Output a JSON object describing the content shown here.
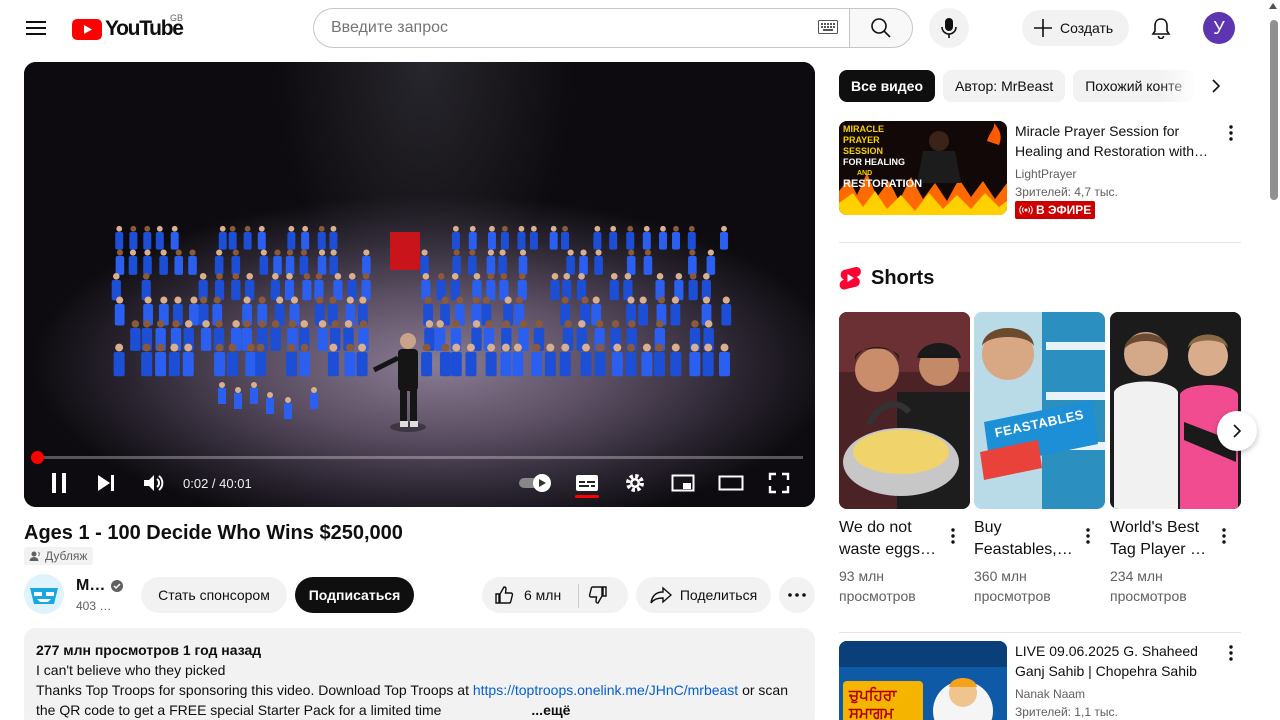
{
  "header": {
    "logo_text": "YouTube",
    "region": "GB",
    "search_placeholder": "Введите запрос",
    "create_label": "Создать",
    "avatar_letter": "У"
  },
  "player": {
    "time_current": "0:02",
    "time_total": "40:01",
    "time_display": "0:02 / 40:01",
    "progress_fraction": 0.001,
    "state": "playing"
  },
  "video": {
    "title": "Ages 1 - 100 Decide Who Wins $250,000",
    "dub_label": "Дубляж",
    "channel_name": "M…",
    "subscribers": "403 …",
    "sponsor_label": "Стать спонсором",
    "subscribe_label": "Подписаться",
    "likes": "6 млн",
    "share_label": "Поделиться"
  },
  "description": {
    "meta": "277 млн просмотров  1 год назад",
    "line1": "I can't believe who they picked",
    "line2_prefix": "Thanks Top Troops for sponsoring this video. Download Top Troops at ",
    "link": "https://toptroops.onelink.me/JHnC/mrbeast",
    "line2_suffix": " or scan",
    "line3": "the QR code to get a FREE special Starter Pack for a limited time",
    "more": "...ещё"
  },
  "sidebar": {
    "chips": [
      "Все видео",
      "Автор: MrBeast",
      "Похожий конте"
    ],
    "shorts_title": "Shorts",
    "recommendations": [
      {
        "title": "Miracle Prayer Session for Healing and Restoration with…",
        "channel": "LightPrayer",
        "meta": "Зрителей: 4,7 тыс.",
        "badge": "В ЭФИРЕ",
        "thumb_text": [
          "MIRACLE",
          "PRAYER",
          "SESSION",
          "FOR HEALING",
          "AND",
          "RESTORATION"
        ]
      },
      {
        "title": "LIVE 09.06.2025 G. Shaheed Ganj Sahib | Chopehra Sahib |…",
        "channel": "Nanak Naam",
        "meta": "Зрителей: 1,1 тыс.",
        "thumb_text": [
          "ਚੁਪਹਿਰਾ",
          "ਸਮਾਗਮ"
        ]
      }
    ],
    "shorts": [
      {
        "title": "We do not waste eggs…",
        "views": "93 млн просмотров"
      },
      {
        "title": "Buy Feastables,…",
        "views": "360 млн просмотров",
        "thumb_text": "FEASTABLES"
      },
      {
        "title": "World's Best Tag Player …",
        "views": "234 млн просмотров"
      }
    ]
  },
  "colors": {
    "accent_red": "#ff0000",
    "link_blue": "#065fd4",
    "live_red": "#cc0000",
    "avatar_purple": "#5e35b1"
  }
}
